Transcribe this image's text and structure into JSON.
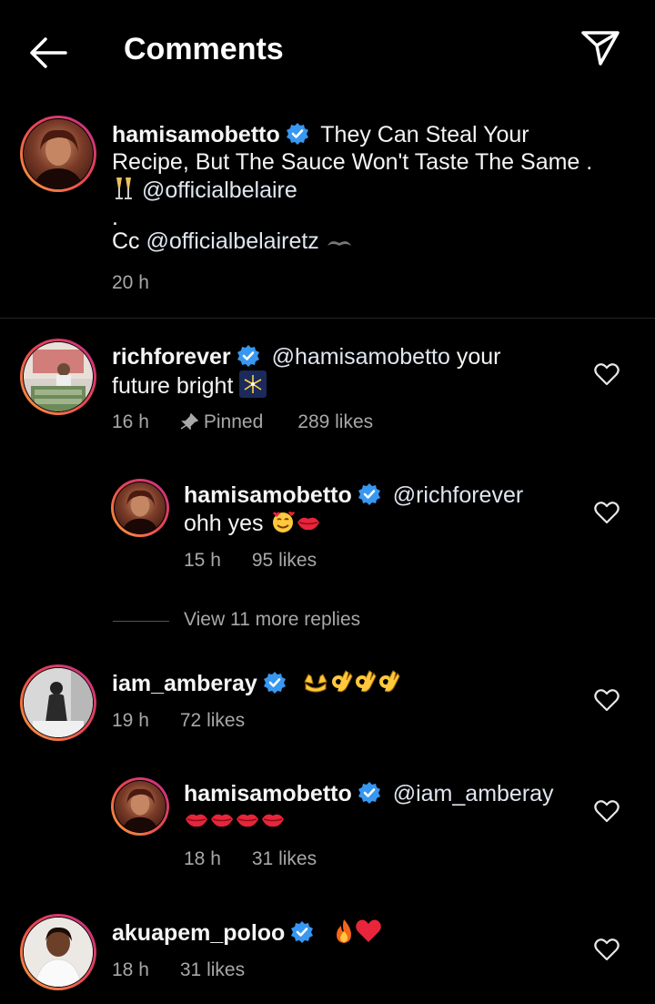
{
  "header": {
    "title": "Comments"
  },
  "caption": {
    "username": "hamisamobetto",
    "line1": "They Can Steal Your",
    "line2": "Recipe, But The Sauce Won't Taste The Same .",
    "mention1": "@officialbelaire",
    "dot": ".",
    "cc": "Cc",
    "mention2": "@officialbelairetz",
    "time": "20 h"
  },
  "comments": [
    {
      "username": "richforever",
      "mention": "@hamisamobetto",
      "text1": "your",
      "text2": "future bright",
      "time": "16 h",
      "pinned": "Pinned",
      "likes": "289 likes"
    },
    {
      "username": "hamisamobetto",
      "mention": "@richforever",
      "text": "ohh yes",
      "time": "15 h",
      "likes": "95 likes"
    },
    {
      "view_more": "View 11 more replies"
    },
    {
      "username": "iam_amberay",
      "time": "19 h",
      "likes": "72 likes"
    },
    {
      "username": "hamisamobetto",
      "mention": "@iam_amberay",
      "time": "18 h",
      "likes": "31 likes"
    },
    {
      "username": "akuapem_poloo",
      "time": "18 h",
      "likes": "31 likes"
    }
  ],
  "colors": {
    "background": "#000000",
    "text": "#f5f5f5",
    "muted": "#a8a8a8",
    "verified": "#3897f0"
  }
}
